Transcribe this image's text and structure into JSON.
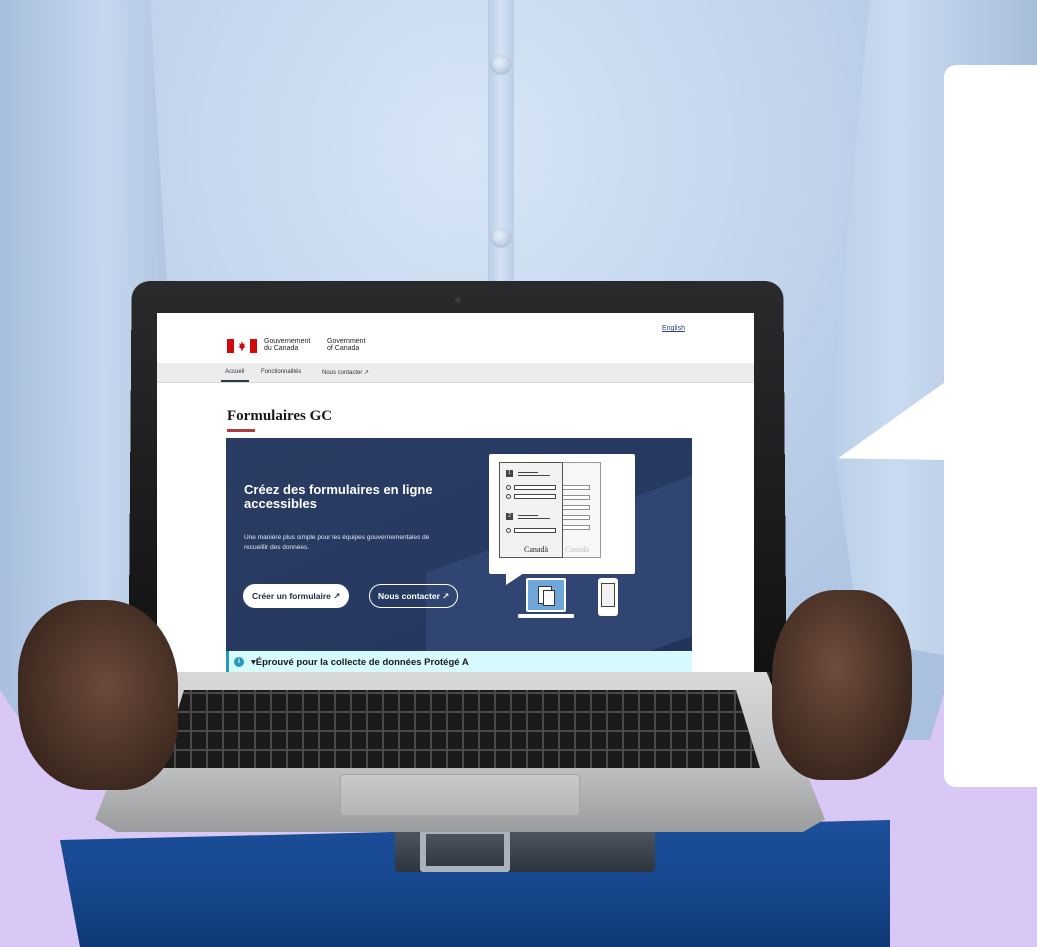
{
  "screen_page": {
    "language_toggle": "English",
    "gov_wordmark_fr": [
      "Gouvernement",
      "du Canada"
    ],
    "gov_wordmark_en": [
      "Government",
      "of Canada"
    ],
    "nav": [
      "Accueil",
      "Fonctionnalités",
      "Nous contacter ↗"
    ],
    "page_title": "Formulaires GC",
    "hero": {
      "heading": "Créez des formulaires en ligne accessibles",
      "text": "Une manière plus simple pour les équipes gouvernementales de recueillir des données.",
      "primary_button": "Créer un formulaire ↗",
      "secondary_button": "Nous contacter ↗",
      "illustration_numbers": [
        "1",
        "2"
      ],
      "illustration_wordmark": "Canadä",
      "illustration_wordmark_faded": "Canadä"
    },
    "alert": {
      "icon": "i",
      "text": "▾Éprouvé pour la collecte de données Protégé A"
    }
  },
  "colors": {
    "background": "#d9c8f5",
    "hero_bg": "#273a61",
    "accent_red": "#af3c43",
    "alert_bg": "#d7faff",
    "alert_border": "#269abc"
  },
  "icons": {
    "flag": "canada-flag-icon",
    "external": "external-link-icon",
    "info": "info-icon"
  }
}
